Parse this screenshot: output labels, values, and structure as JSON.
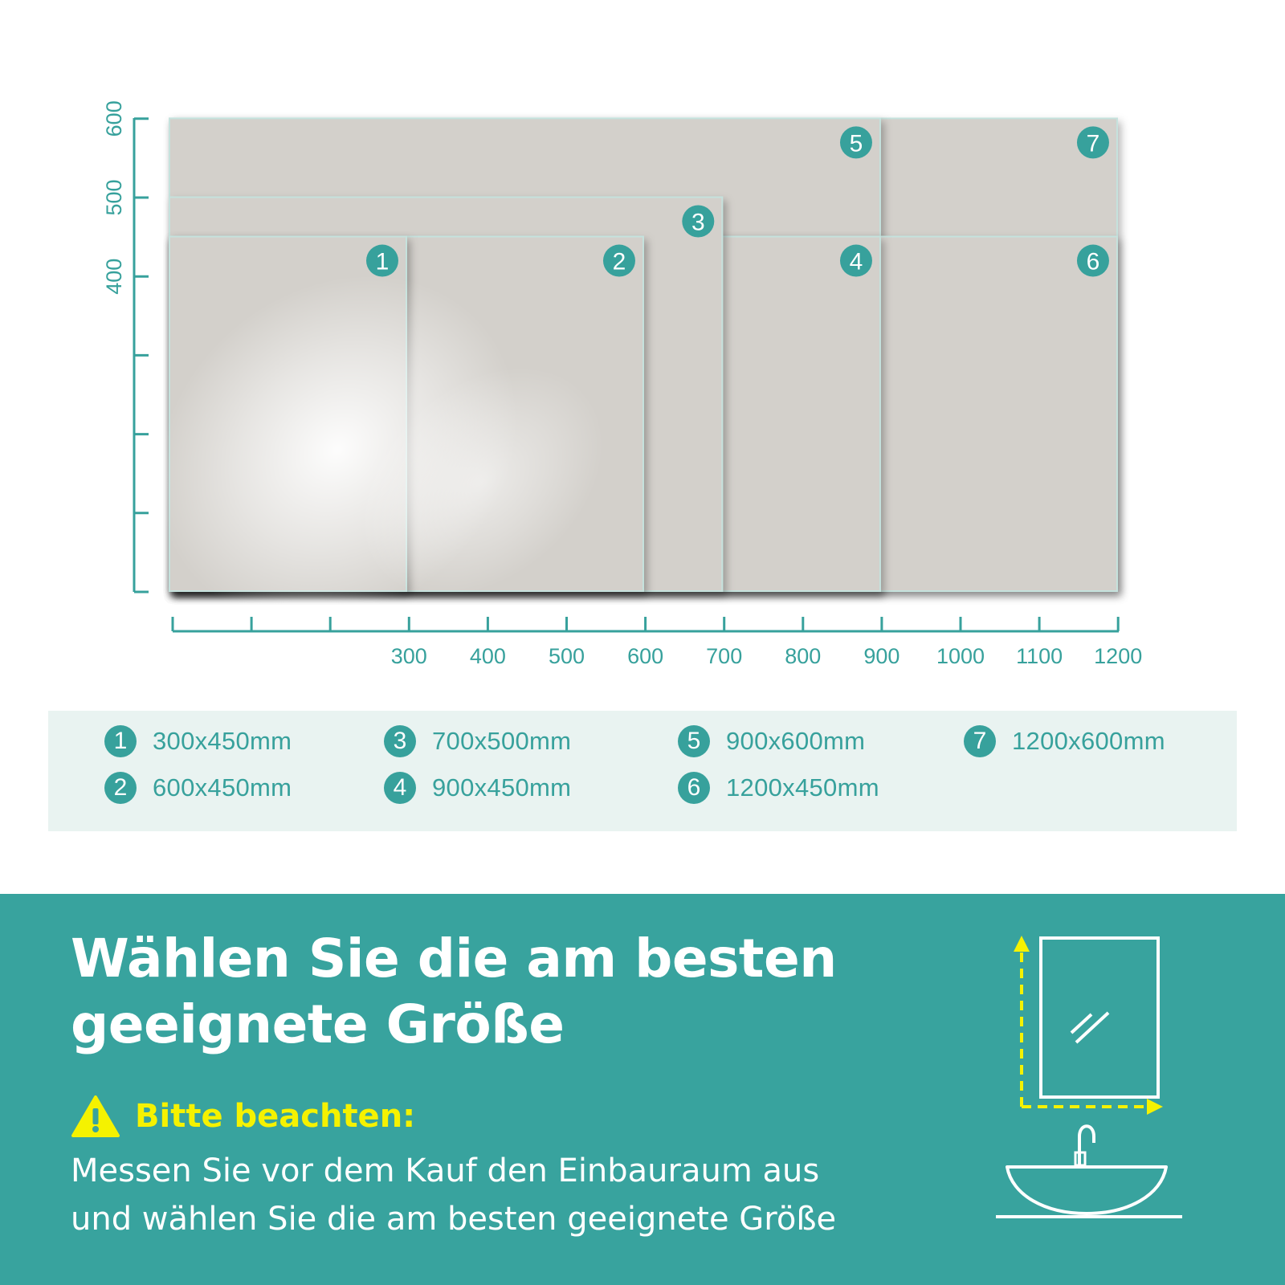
{
  "colors": {
    "accent": "#37a19c",
    "mirror": "#d3d0cb",
    "legend_bg": "#e9f3f1",
    "warning": "#f5f200"
  },
  "diagram": {
    "y_axis_ticks": [
      "400",
      "500",
      "600"
    ],
    "x_axis_ticks": [
      "300",
      "400",
      "500",
      "600",
      "700",
      "800",
      "900",
      "1000",
      "1100",
      "1200"
    ],
    "mirrors": [
      {
        "number": "1",
        "width_mm": 300,
        "height_mm": 450
      },
      {
        "number": "2",
        "width_mm": 600,
        "height_mm": 450
      },
      {
        "number": "3",
        "width_mm": 700,
        "height_mm": 500
      },
      {
        "number": "4",
        "width_mm": 900,
        "height_mm": 450
      },
      {
        "number": "5",
        "width_mm": 900,
        "height_mm": 600
      },
      {
        "number": "6",
        "width_mm": 1200,
        "height_mm": 450
      },
      {
        "number": "7",
        "width_mm": 1200,
        "height_mm": 600
      }
    ]
  },
  "legend": [
    {
      "number": "1",
      "label": "300x450mm"
    },
    {
      "number": "2",
      "label": "600x450mm"
    },
    {
      "number": "3",
      "label": "700x500mm"
    },
    {
      "number": "4",
      "label": "900x450mm"
    },
    {
      "number": "5",
      "label": "900x600mm"
    },
    {
      "number": "6",
      "label": "1200x450mm"
    },
    {
      "number": "7",
      "label": "1200x600mm"
    }
  ],
  "banner": {
    "headline_line1": "Wählen Sie die am besten",
    "headline_line2": "geeignete Größe",
    "warning_title": "Bitte beachten:",
    "body_line1": "Messen Sie vor dem Kauf den Einbauraum aus",
    "body_line2": "und wählen Sie die am besten geeignete Größe"
  },
  "icons": {
    "warning": "warning-triangle-icon",
    "mirror": "mirror-measure-icon",
    "sink": "sink-faucet-icon"
  }
}
